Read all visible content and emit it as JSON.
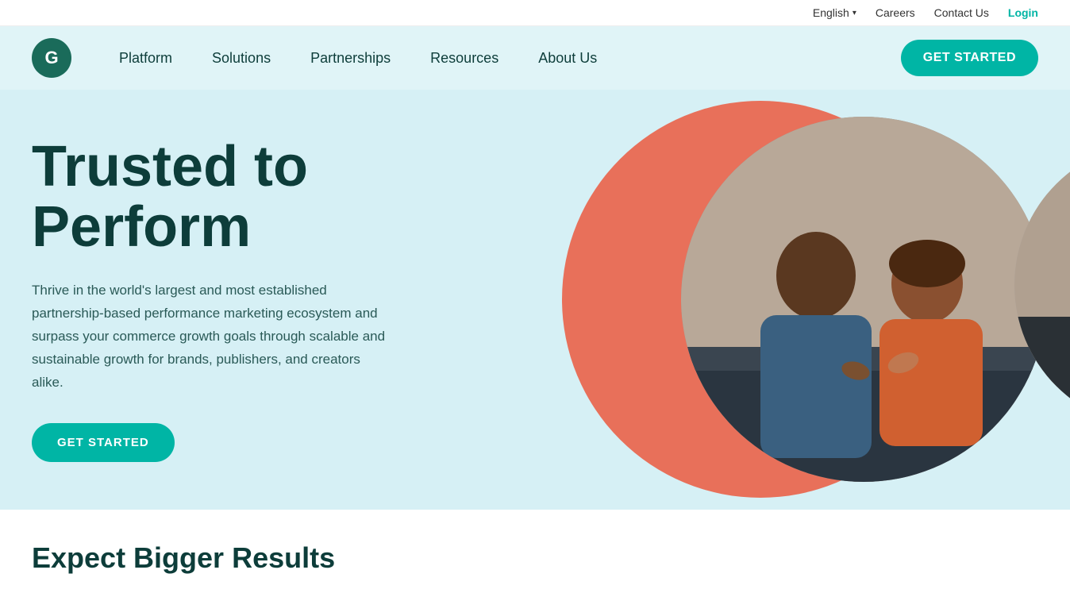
{
  "topbar": {
    "language": "English",
    "language_chevron": "▾",
    "careers": "Careers",
    "contact_us": "Contact Us",
    "login": "Login"
  },
  "nav": {
    "logo_letter": "G",
    "links": [
      {
        "label": "Platform"
      },
      {
        "label": "Solutions"
      },
      {
        "label": "Partnerships"
      },
      {
        "label": "Resources"
      },
      {
        "label": "About Us"
      }
    ],
    "get_started": "GET STARTED"
  },
  "hero": {
    "title_line1": "Trusted to",
    "title_line2": "Perform",
    "description": "Thrive in the world's largest and most established partnership-based performance marketing ecosystem and surpass your commerce growth goals through scalable and sustainable growth for brands, publishers, and creators alike.",
    "cta": "GET STARTED"
  },
  "bottom_teaser": {
    "title": "Expect Bigger Results"
  }
}
